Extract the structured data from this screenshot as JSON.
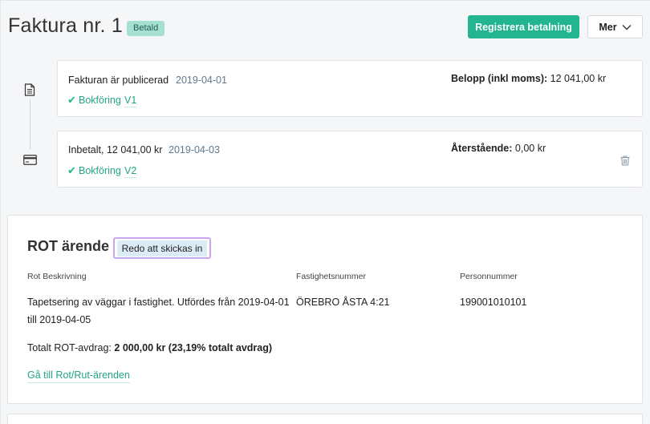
{
  "header": {
    "title": "Faktura nr. 1",
    "status_badge": "Betald",
    "register_payment_label": "Registrera betalning",
    "more_label": "Mer"
  },
  "timeline": {
    "events": [
      {
        "title": "Fakturan är publicerad",
        "date": "2019-04-01",
        "check": "✔",
        "link_label": "Bokföring",
        "voucher": "V1",
        "amount_label": "Belopp (inkl moms):",
        "amount_value": "12 041,00 kr"
      },
      {
        "title": "Inbetalt, 12 041,00 kr",
        "date": "2019-04-03",
        "check": "✔",
        "link_label": "Bokföring",
        "voucher": "V2",
        "amount_label": "Återstående:",
        "amount_value": "0,00 kr"
      }
    ]
  },
  "rot": {
    "title": "ROT ärende",
    "status": "Redo att skickas in",
    "columns": [
      {
        "label": "Rot Beskrivning",
        "value_line1": "Tapetsering av väggar i fastighet. Utfördes från 2019-04-01",
        "value_line2": "till 2019-04-05"
      },
      {
        "label": "Fastighetsnummer",
        "value_line1": "ÖREBRO ÅSTA 4:21"
      },
      {
        "label": "Personnummer",
        "value_line1": "199001010101"
      }
    ],
    "total_label": "Totalt ROT-avdrag:",
    "total_value": "2 000,00 kr (23,19% totalt avdrag)",
    "link_label": "Gå till Rot/Rut-ärenden"
  },
  "colors": {
    "accent": "#23b58f",
    "badge_paid_bg": "#a6e0d2",
    "status_outline": "#c8a7ef",
    "status_bg": "#dcecf6"
  },
  "icons": [
    "document-icon",
    "credit-card-icon",
    "chevron-down-icon",
    "trash-icon",
    "checkmark-icon"
  ]
}
